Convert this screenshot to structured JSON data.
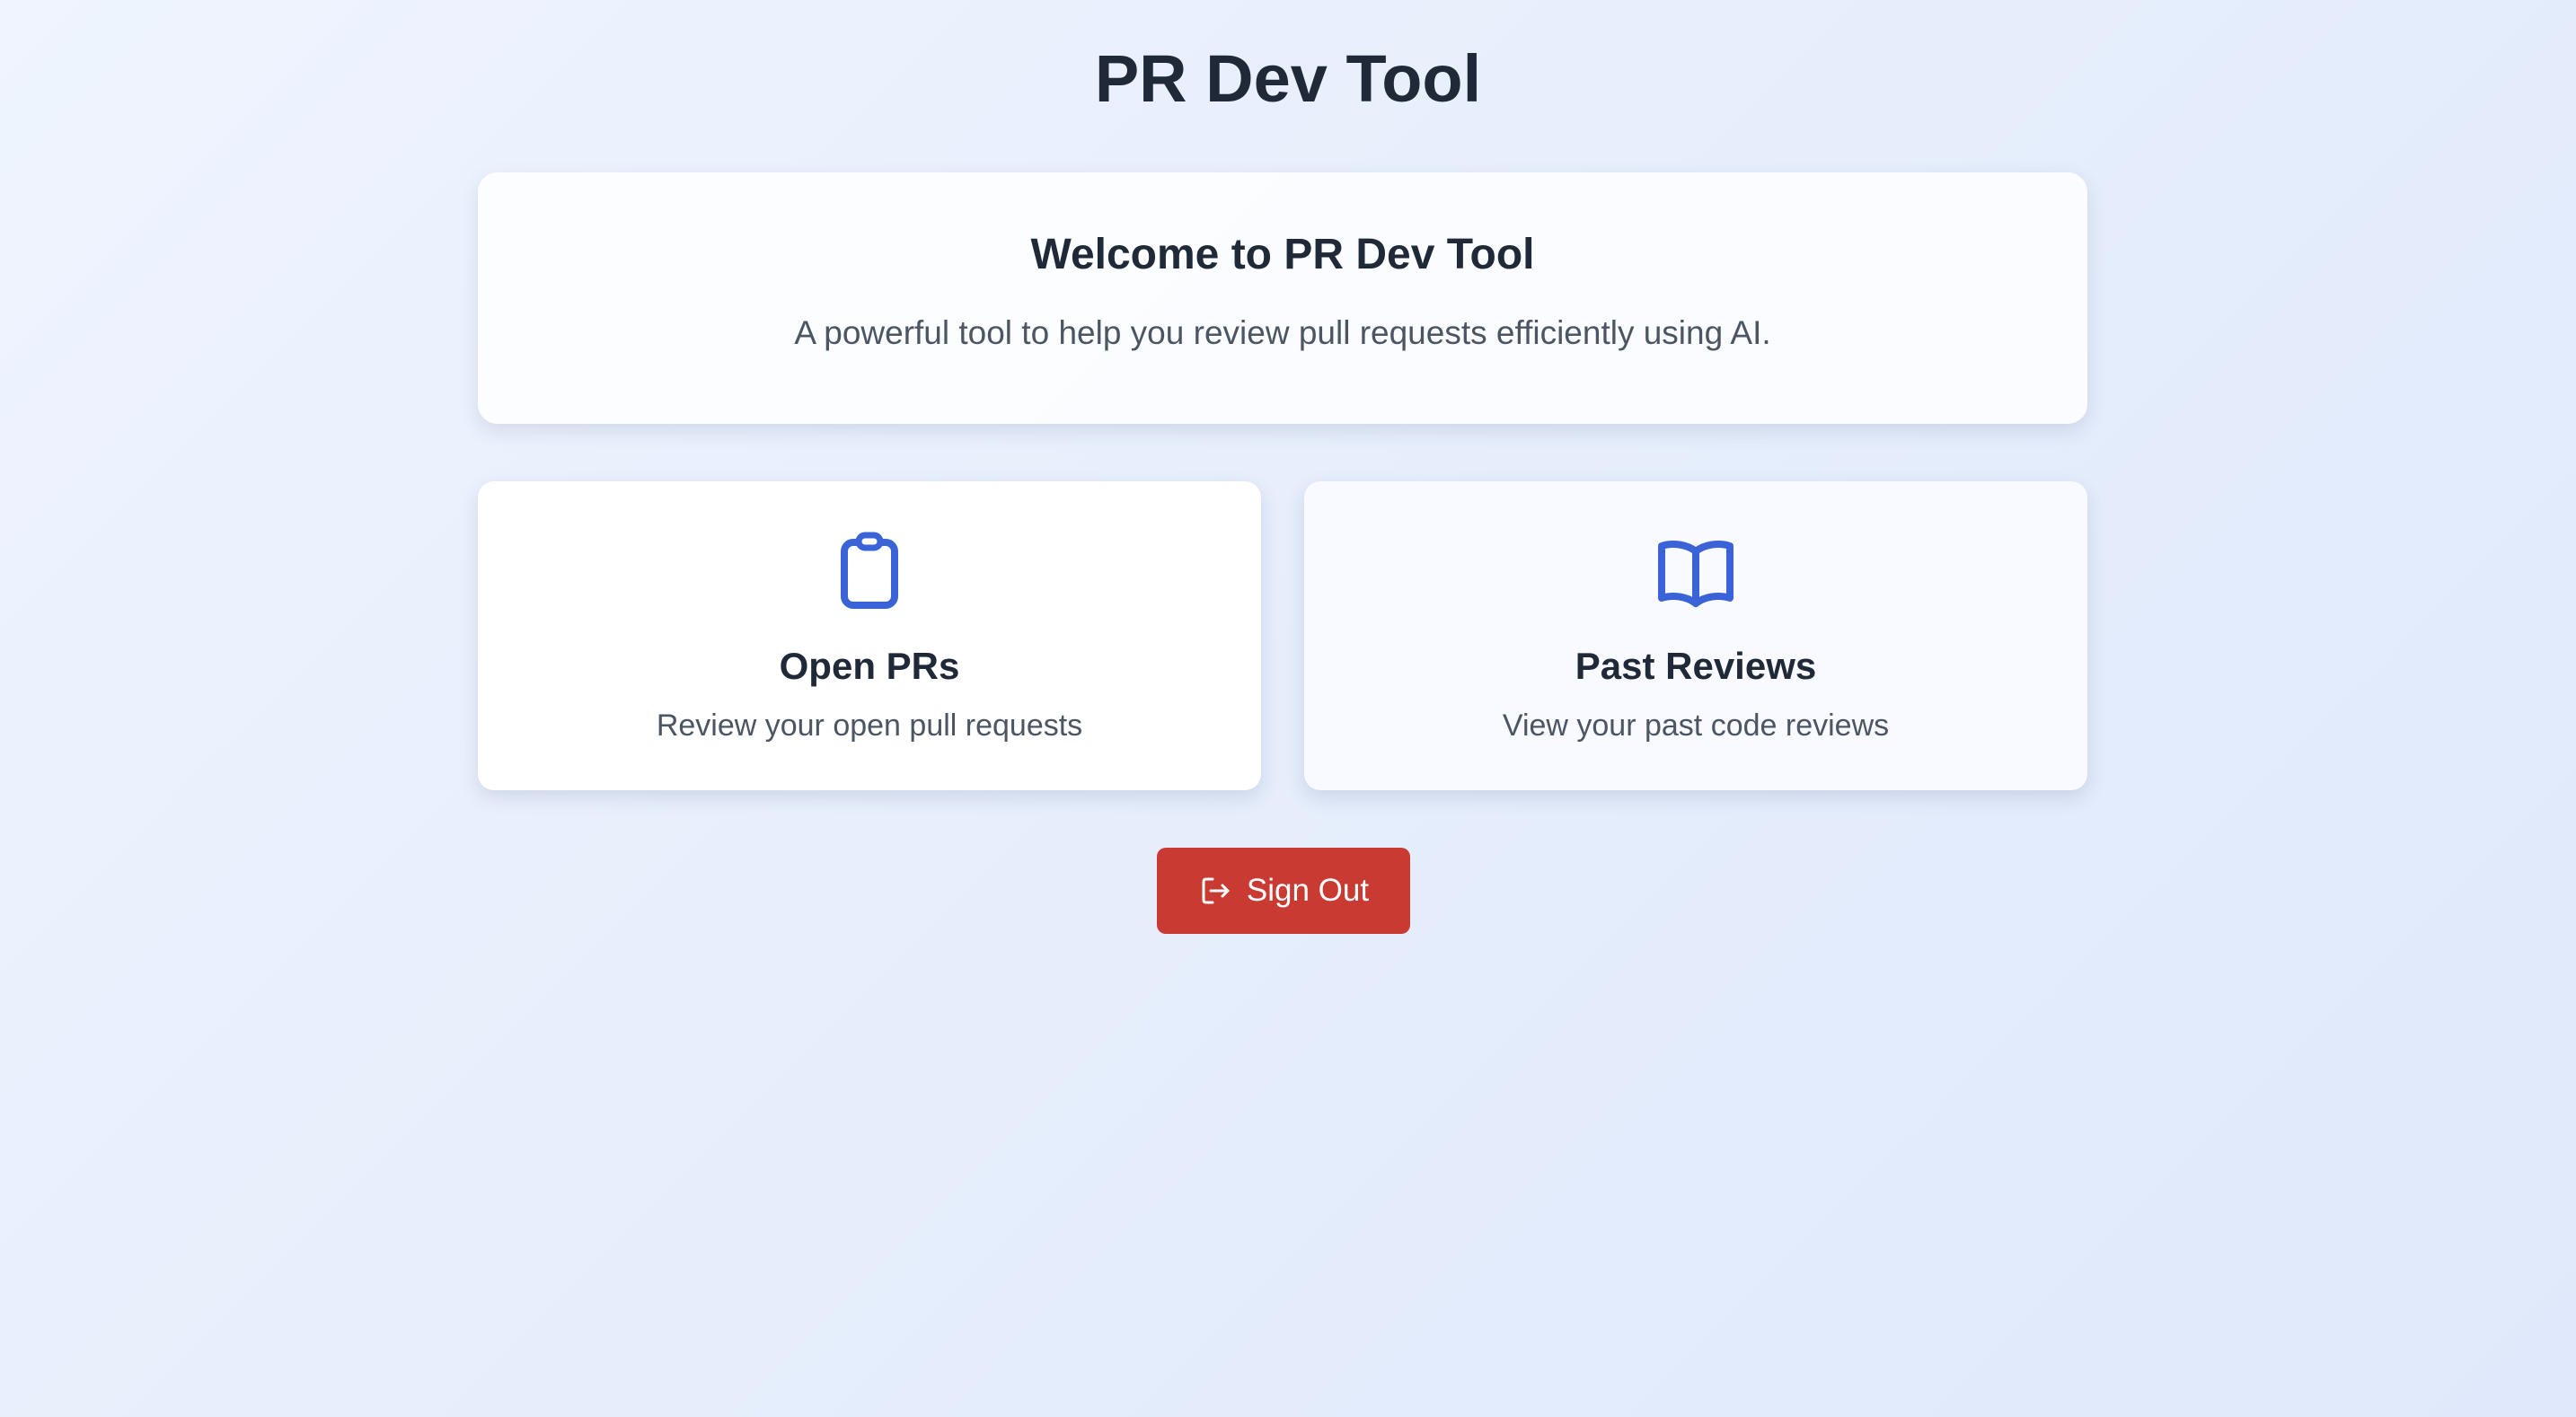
{
  "app": {
    "title": "PR Dev Tool"
  },
  "welcome": {
    "title": "Welcome to PR Dev Tool",
    "description": "A powerful tool to help you review pull requests efficiently using AI."
  },
  "cards": [
    {
      "icon": "clipboard-icon",
      "title": "Open PRs",
      "description": "Review your open pull requests"
    },
    {
      "icon": "book-open-icon",
      "title": "Past Reviews",
      "description": "View your past code reviews"
    }
  ],
  "actions": {
    "signout_label": "Sign Out",
    "signout_icon": "logout-icon"
  },
  "colors": {
    "accent": "#3b63d8",
    "danger": "#c83a32",
    "text_primary": "#1f2937",
    "text_secondary": "#4b5563"
  }
}
